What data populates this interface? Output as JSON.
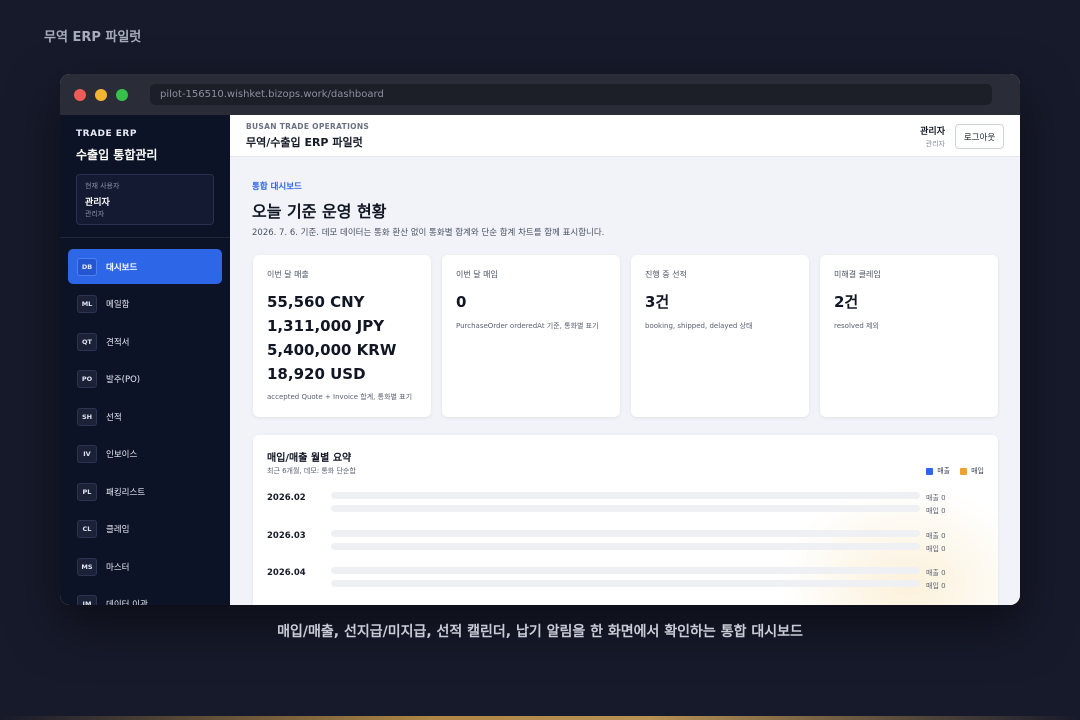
{
  "stage_title": "무역 ERP 파일럿",
  "caption": "매입/매출, 선지급/미지급, 선적 캘린더, 납기 알림을 한 화면에서 확인하는 통합 대시보드",
  "browser": {
    "url": "pilot-156510.wishket.bizops.work/dashboard"
  },
  "sidebar": {
    "brand_small": "TRADE ERP",
    "brand_title": "수출입 통합관리",
    "user_box": {
      "caption": "현재 사용자",
      "name": "관리자",
      "role": "관리자"
    },
    "items": [
      {
        "code": "DB",
        "label": "대시보드",
        "active": true
      },
      {
        "code": "ML",
        "label": "메일함"
      },
      {
        "code": "QT",
        "label": "견적서"
      },
      {
        "code": "PO",
        "label": "발주(PO)"
      },
      {
        "code": "SH",
        "label": "선적"
      },
      {
        "code": "IV",
        "label": "인보이스"
      },
      {
        "code": "PL",
        "label": "패킹리스트"
      },
      {
        "code": "CL",
        "label": "클레임"
      },
      {
        "code": "MS",
        "label": "마스터"
      },
      {
        "code": "IM",
        "label": "데이터 이관"
      }
    ]
  },
  "topbar": {
    "eyebrow": "BUSAN TRADE OPERATIONS",
    "title": "무역/수출입 ERP 파일럿",
    "user_name": "관리자",
    "user_role": "관리자",
    "logout_label": "로그아웃"
  },
  "header": {
    "eyebrow": "통합 대시보드",
    "title": "오늘 기준 운영 현황",
    "description": "2026. 7. 6. 기준. 데모 데이터는 통화 환산 없이 통화별 합계와 단순 합계 차트를 함께 표시합니다."
  },
  "cards": [
    {
      "label": "이번 달 매출",
      "values": [
        "55,560 CNY",
        "1,311,000 JPY",
        "5,400,000 KRW",
        "18,920 USD"
      ],
      "note": "accepted Quote + Invoice 합계, 통화별 표기"
    },
    {
      "label": "이번 달 매입",
      "values": [
        "0"
      ],
      "note": "PurchaseOrder orderedAt 기준, 통화별 표기"
    },
    {
      "label": "진행 중 선적",
      "values": [
        "3건"
      ],
      "note": "booking, shipped, delayed 상태"
    },
    {
      "label": "미해결 클레임",
      "values": [
        "2건"
      ],
      "note": "resolved 제외"
    }
  ],
  "monthly_panel": {
    "title": "매입/매출 월별 요약",
    "subtitle": "최근 6개월, 데모: 통화 단순합",
    "legend": [
      {
        "label": "매출",
        "color": "#2e66e8"
      },
      {
        "label": "매입",
        "color": "#f0a030"
      }
    ],
    "rows": [
      {
        "month": "2026.02",
        "sales_label": "매출 0",
        "purchase_label": "매입 0",
        "sales": 0,
        "purchase": 0
      },
      {
        "month": "2026.03",
        "sales_label": "매출 0",
        "purchase_label": "매입 0",
        "sales": 0,
        "purchase": 0
      },
      {
        "month": "2026.04",
        "sales_label": "매출 0",
        "purchase_label": "매입 0",
        "sales": 0,
        "purchase": 0
      }
    ]
  }
}
